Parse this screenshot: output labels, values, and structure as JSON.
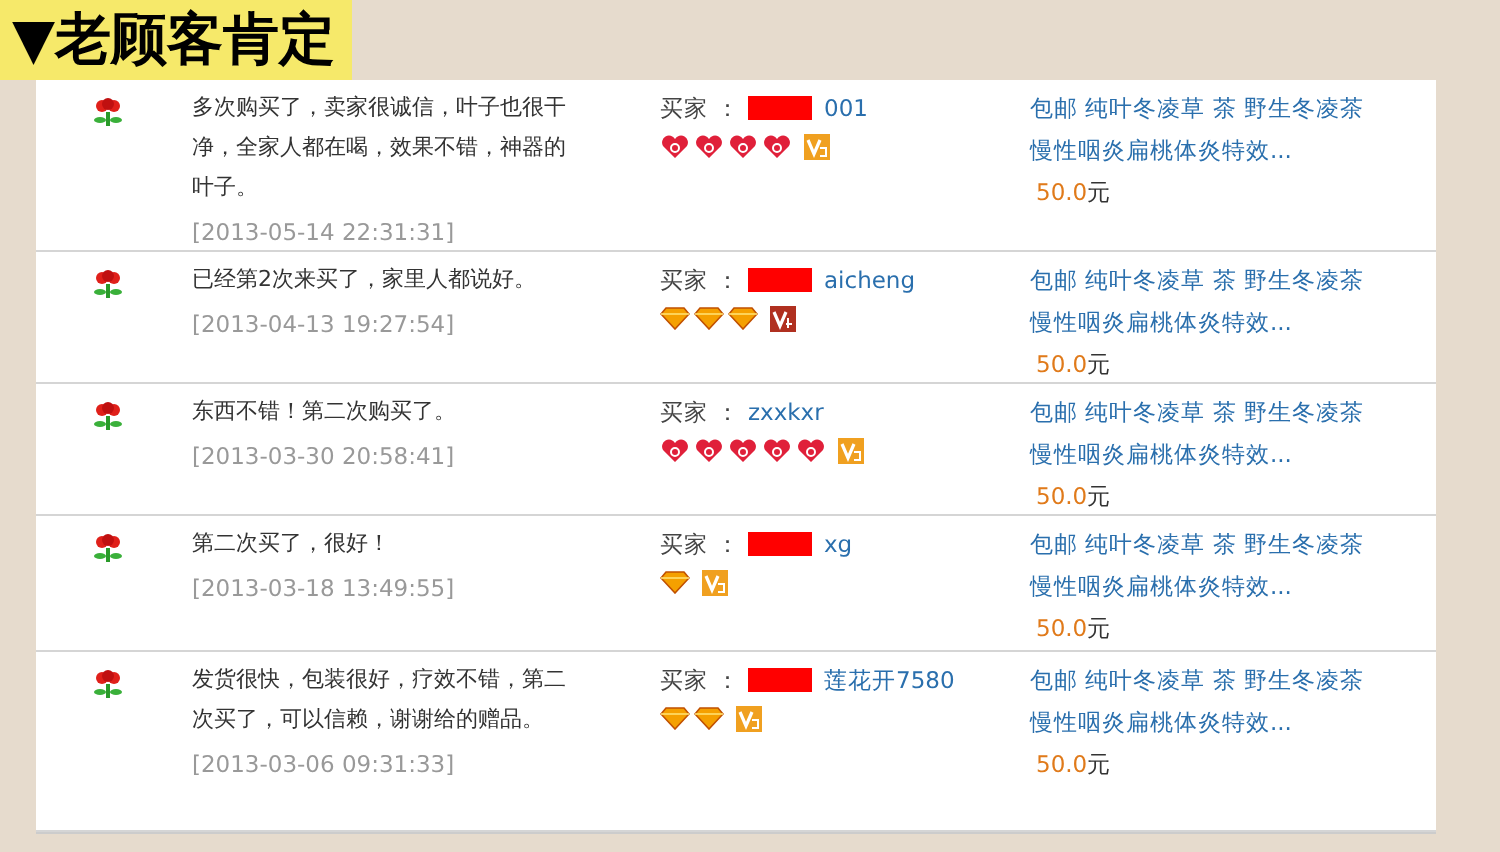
{
  "header": {
    "title": "▼老顾客肯定"
  },
  "reviews": [
    {
      "comment": "多次购买了，卖家很诚信，叶子也很干净，全家人都在喝，效果不错，神器的叶子。",
      "time": "[2013-05-14 22:31:31]",
      "buyer_label": "买家",
      "buyer_sep": "：",
      "buyer": "001",
      "redacted": true,
      "badges": [
        {
          "kind": "heart"
        },
        {
          "kind": "heart"
        },
        {
          "kind": "heart"
        },
        {
          "kind": "heart"
        },
        {
          "kind": "vip3"
        }
      ],
      "product": "包邮 纯叶冬凌草 茶 野生冬凌茶慢性咽炎扁桃体炎特效...",
      "price": "50.0",
      "currency": "元"
    },
    {
      "comment": "已经第2次来买了，家里人都说好。",
      "time": "[2013-04-13 19:27:54]",
      "buyer_label": "买家",
      "buyer_sep": "：",
      "buyer": "aicheng",
      "redacted": true,
      "badges": [
        {
          "kind": "diamond"
        },
        {
          "kind": "diamond"
        },
        {
          "kind": "diamond"
        },
        {
          "kind": "vip4"
        }
      ],
      "product": "包邮 纯叶冬凌草 茶 野生冬凌茶慢性咽炎扁桃体炎特效...",
      "price": "50.0",
      "currency": "元"
    },
    {
      "comment": "东西不错！第二次购买了。",
      "time": "[2013-03-30 20:58:41]",
      "buyer_label": "买家",
      "buyer_sep": "：",
      "buyer": "zxxkxr",
      "redacted": false,
      "badges": [
        {
          "kind": "heart"
        },
        {
          "kind": "heart"
        },
        {
          "kind": "heart"
        },
        {
          "kind": "heart"
        },
        {
          "kind": "heart"
        },
        {
          "kind": "vip3"
        }
      ],
      "product": "包邮 纯叶冬凌草 茶 野生冬凌茶慢性咽炎扁桃体炎特效...",
      "price": "50.0",
      "currency": "元"
    },
    {
      "comment": "第二次买了，很好！",
      "time": "[2013-03-18 13:49:55]",
      "buyer_label": "买家",
      "buyer_sep": "：",
      "buyer": "xg",
      "redacted": true,
      "badges": [
        {
          "kind": "diamond"
        },
        {
          "kind": "vip3"
        }
      ],
      "product": "包邮 纯叶冬凌草 茶 野生冬凌茶慢性咽炎扁桃体炎特效...",
      "price": "50.0",
      "currency": "元"
    },
    {
      "comment": "发货很快，包装很好，疗效不错，第二次买了，可以信赖，谢谢给的赠品。",
      "time": "[2013-03-06 09:31:33]",
      "buyer_label": "买家",
      "buyer_sep": "：",
      "buyer": "莲花开7580",
      "redacted": true,
      "badges": [
        {
          "kind": "diamond"
        },
        {
          "kind": "diamond"
        },
        {
          "kind": "vip3"
        }
      ],
      "product": "包邮 纯叶冬凌草 茶 野生冬凌茶慢性咽炎扁桃体炎特效...",
      "price": "50.0",
      "currency": "元"
    }
  ]
}
